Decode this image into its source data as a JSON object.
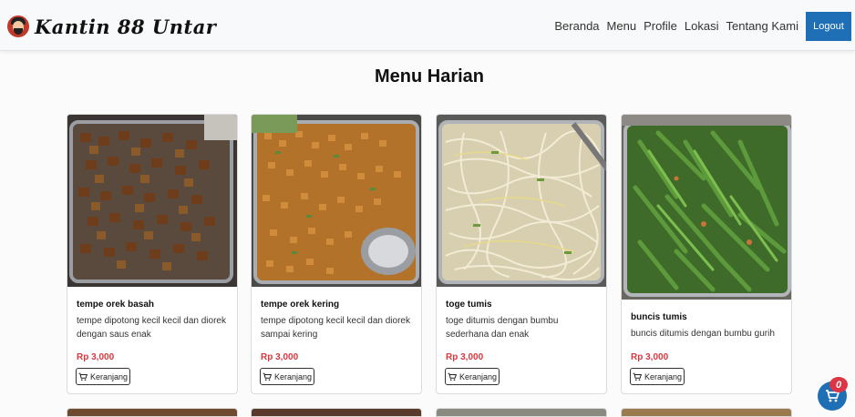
{
  "brand": {
    "name": "Kantin 88 Untar"
  },
  "nav": {
    "items": [
      "Beranda",
      "Menu",
      "Profile",
      "Lokasi",
      "Tentang Kami"
    ],
    "logout_label": "Logout"
  },
  "page": {
    "title": "Menu Harian"
  },
  "menu_items": [
    {
      "name": "tempe orek basah",
      "description": "tempe dipotong kecil kecil dan diorek dengan saus enak",
      "price": "Rp 3,000",
      "button_label": "Keranjang"
    },
    {
      "name": "tempe orek kering",
      "description": "tempe dipotong kecil kecil dan diorek sampai kering",
      "price": "Rp 3,000",
      "button_label": "Keranjang"
    },
    {
      "name": "toge tumis",
      "description": "toge ditumis dengan bumbu sederhana dan enak",
      "price": "Rp 3,000",
      "button_label": "Keranjang"
    },
    {
      "name": "buncis tumis",
      "description": "buncis ditumis dengan bumbu gurih",
      "price": "Rp 3,000",
      "button_label": "Keranjang"
    }
  ],
  "cart": {
    "count": "0"
  },
  "colors": {
    "primary": "#1f6fb7",
    "price": "#d9363e",
    "badge": "#dc3545"
  },
  "icons": {
    "cart": "cart-icon",
    "logo": "chef-avatar-icon"
  }
}
